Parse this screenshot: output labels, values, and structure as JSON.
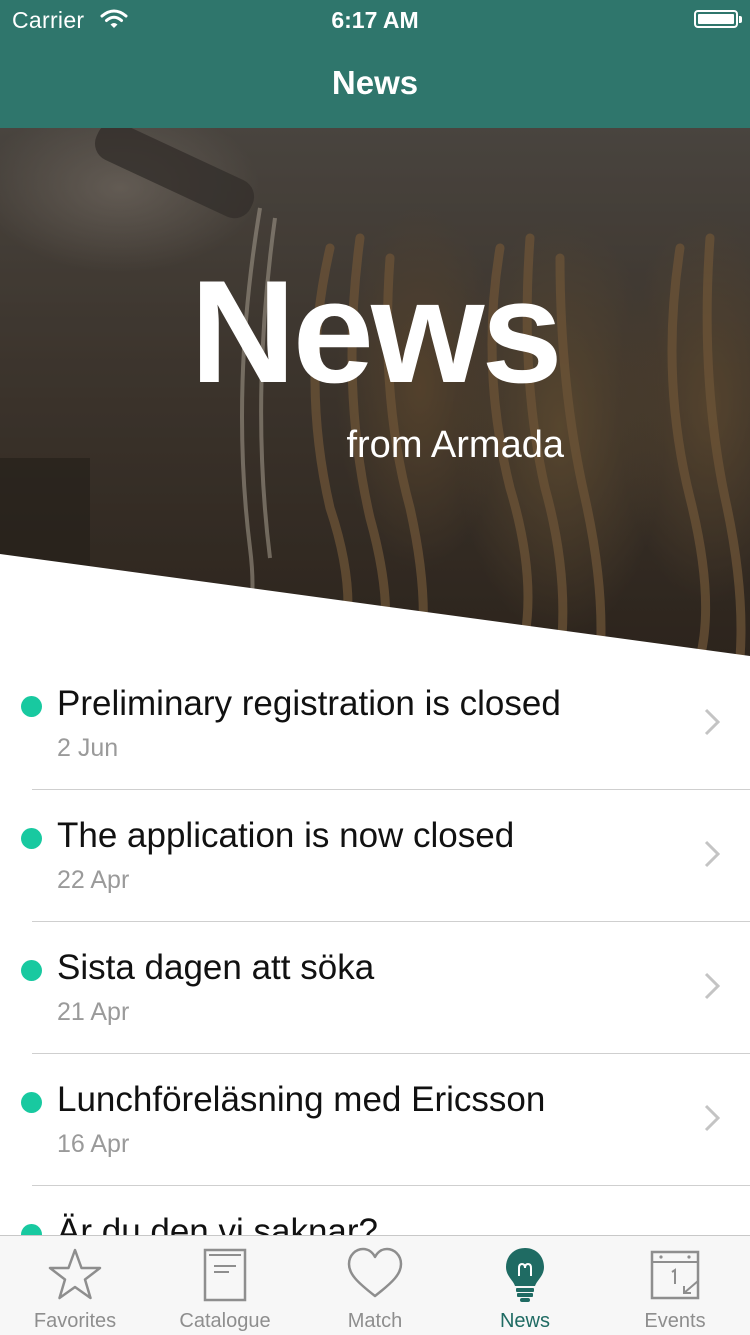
{
  "status_bar": {
    "carrier": "Carrier",
    "time": "6:17 AM"
  },
  "nav": {
    "title": "News"
  },
  "hero": {
    "title": "News",
    "subtitle": "from Armada"
  },
  "news": [
    {
      "title": "Preliminary registration is closed",
      "date": "2 Jun"
    },
    {
      "title": "The application is now closed",
      "date": "22 Apr"
    },
    {
      "title": "Sista dagen att söka",
      "date": "21 Apr"
    },
    {
      "title": "Lunchföreläsning med Ericsson",
      "date": "16 Apr"
    },
    {
      "title": "Är du den vi saknar?",
      "date": ""
    }
  ],
  "tabs": [
    {
      "label": "Favorites",
      "icon": "star-icon"
    },
    {
      "label": "Catalogue",
      "icon": "book-icon"
    },
    {
      "label": "Match",
      "icon": "heart-icon"
    },
    {
      "label": "News",
      "icon": "lightbulb-icon"
    },
    {
      "label": "Events",
      "icon": "calendar-icon"
    }
  ],
  "colors": {
    "nav_bar": "#2f766c",
    "unread_dot": "#18c9a0",
    "active_tab": "#1f6b63",
    "inactive_tab": "#8e8e8e"
  }
}
